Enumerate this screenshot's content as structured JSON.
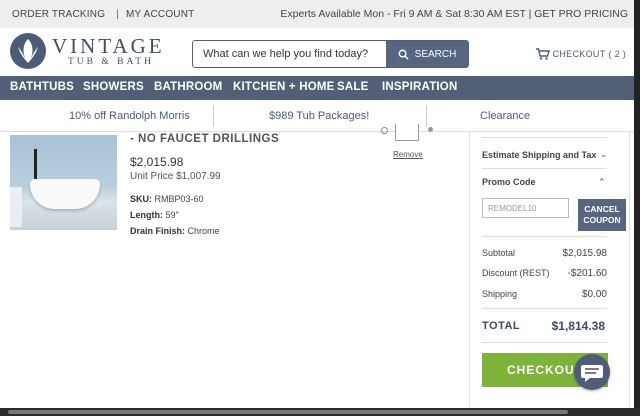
{
  "utility_bar": {
    "order_tracking": "ORDER TRACKING",
    "separator": "|",
    "my_account": "MY ACCOUNT",
    "announcement": "Experts Available Mon - Fri 9 AM & Sat 8:30 AM EST | GET PRO PRICING"
  },
  "logo": {
    "brand": "VINTAGE",
    "sub": "TUB & BATH"
  },
  "search": {
    "placeholder": "What can we help you find today?",
    "button_label": "SEARCH"
  },
  "cart": {
    "label": "CHECKOUT",
    "count": "( 2 )"
  },
  "nav": {
    "items": [
      "BATHTUBS",
      "SHOWERS",
      "BATHROOM",
      "KITCHEN + HOME",
      "SALE",
      "INSPIRATION"
    ]
  },
  "promo_bar": {
    "items": [
      "10% off Randolph Morris",
      "$989 Tub Packages!",
      "Clearance"
    ]
  },
  "cart_item": {
    "name_fragment": "- NO FAUCET DRILLINGS",
    "price": "$2,015.98",
    "unit_price": "Unit Price $1,007.99",
    "sku_label": "SKU:",
    "sku": "RMBP03-60",
    "length_label": "Length:",
    "length": "59\"",
    "drain_label": "Drain Finish:",
    "drain": "Chrome",
    "remove_label": "Remove"
  },
  "summary": {
    "estimate_shipping": "Estimate Shipping and Tax",
    "promo_code_label": "Promo Code",
    "promo_code_value": "REMODEL10",
    "cancel_button": "CANCEL COUPON",
    "rows": [
      {
        "label": "Subtotal",
        "value": "$2,015.98"
      },
      {
        "label": "Discount (REST)",
        "value": "-$201.60"
      },
      {
        "label": "Shipping",
        "value": "$0.00"
      }
    ],
    "total_label": "TOTAL",
    "total_value": "$1,814.38",
    "checkout_button": "CHECKOUT"
  },
  "colors": {
    "nav_bg": "#535f76",
    "brand": "#4a5c78",
    "checkout_green": "#7eb339",
    "utility_bg": "#eeeeee"
  }
}
